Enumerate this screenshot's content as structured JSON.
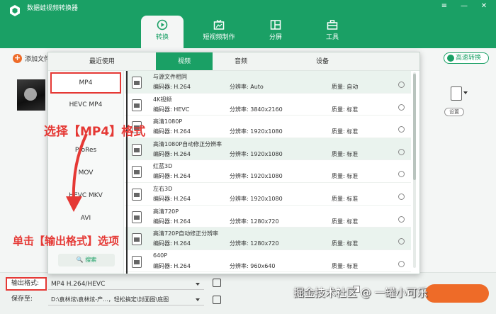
{
  "app": {
    "title": "数据蛙视频转换器",
    "window_controls": {
      "menu": "≡",
      "minimize": "—",
      "close": "✕"
    }
  },
  "nav_tabs": [
    {
      "label": "转换",
      "icon": "convert-icon",
      "active": true
    },
    {
      "label": "短视频制作",
      "icon": "video-maker-icon",
      "active": false
    },
    {
      "label": "分屏",
      "icon": "split-screen-icon",
      "active": false
    },
    {
      "label": "工具",
      "icon": "toolbox-icon",
      "active": false
    }
  ],
  "toolbar": {
    "add_file_label": "添加文件",
    "speed_convert_label": "高速转换",
    "settings_label": "设置"
  },
  "format_popup": {
    "tabs": [
      "最近使用",
      "视频",
      "音频",
      "设备"
    ],
    "active_tab": "视频",
    "formats": [
      "MP4",
      "HEVC MP4",
      "MOV",
      "ProRes",
      "MKV",
      "HEVC MKV",
      "AVI"
    ],
    "selected_format": "MP4",
    "search_label": "搜索",
    "presets": [
      {
        "name": "与源文件相同",
        "encoder": "编码器: H.264",
        "resolution": "分辨率: Auto",
        "quality": "质量: 自动"
      },
      {
        "name": "4K视频",
        "encoder": "编码器: HEVC",
        "resolution": "分辨率: 3840x2160",
        "quality": "质量: 标准"
      },
      {
        "name": "高清1080P",
        "encoder": "编码器: H.264",
        "resolution": "分辨率: 1920x1080",
        "quality": "质量: 标准"
      },
      {
        "name": "高清1080P自动修正分辨率",
        "encoder": "编码器: H.264",
        "resolution": "分辨率: 1920x1080",
        "quality": "质量: 标准"
      },
      {
        "name": "红蓝3D",
        "encoder": "编码器: H.264",
        "resolution": "分辨率: 1920x1080",
        "quality": "质量: 标准"
      },
      {
        "name": "左右3D",
        "encoder": "编码器: H.264",
        "resolution": "分辨率: 1920x1080",
        "quality": "质量: 标准"
      },
      {
        "name": "高清720P",
        "encoder": "编码器: H.264",
        "resolution": "分辨率: 1280x720",
        "quality": "质量: 标准"
      },
      {
        "name": "高清720P自动修正分辨率",
        "encoder": "编码器: H.264",
        "resolution": "分辨率: 1280x720",
        "quality": "质量: 标准"
      },
      {
        "name": "640P",
        "encoder": "编码器: H.264",
        "resolution": "分辨率: 960x640",
        "quality": "质量: 标准"
      }
    ]
  },
  "output": {
    "format_label": "输出格式:",
    "format_value": "MP4 H.264/HEVC",
    "save_label": "保存至:",
    "save_value": "D:\\袁林炫\\袁林炫-产...，轻松搞定\\封面图\\底图"
  },
  "annotations": {
    "select_mp4": "选择【MP4】格式",
    "click_output": "单击【输出格式】选项"
  },
  "watermark": "掘金技术社区 @ 一罐小可乐",
  "colors": {
    "brand_green": "#1aa065",
    "accent_orange": "#ee6b28",
    "annotation_red": "#e53935"
  }
}
